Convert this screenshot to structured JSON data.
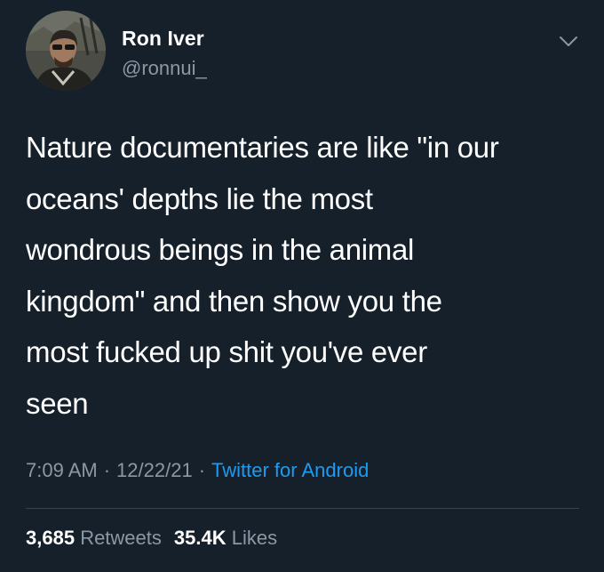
{
  "colors": {
    "background": "#15202b",
    "primary_text": "#ffffff",
    "secondary_text": "#8b98a5",
    "link": "#1d9bf0",
    "divider": "#38444d"
  },
  "author": {
    "display_name": "Ron Iver",
    "handle": "@ronnui_",
    "avatar_icon": "user-photo",
    "menu_icon": "chevron-down-icon"
  },
  "tweet": {
    "lines": [
      "Nature documentaries are like \"in our",
      "oceans' depths lie the most",
      "wondrous beings in the animal",
      "kingdom\" and then show you the",
      "most fucked up shit you've ever",
      "seen"
    ]
  },
  "meta": {
    "time": "7:09 AM",
    "separator": "·",
    "date": "12/22/21",
    "source": "Twitter for Android"
  },
  "stats": {
    "retweets_count": "3,685",
    "retweets_label": "Retweets",
    "likes_count": "35.4K",
    "likes_label": "Likes"
  }
}
